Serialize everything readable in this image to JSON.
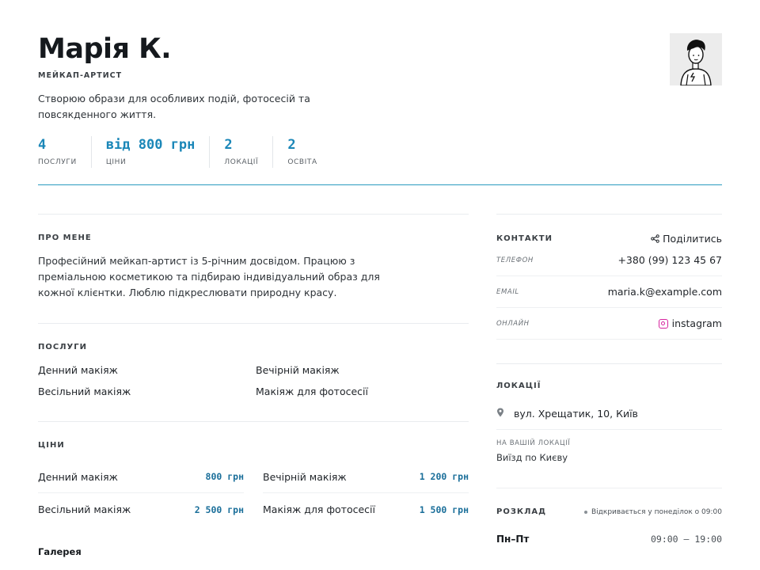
{
  "profile": {
    "name": "Марія К.",
    "role": "МЕЙКАП-АРТИСТ",
    "tagline": "Створюю образи для особливих подій, фотосесій та повсякденного життя."
  },
  "stats": [
    {
      "value": "4",
      "label": "ПОСЛУГИ"
    },
    {
      "value": "від 800 грн",
      "label": "ЦІНИ"
    },
    {
      "value": "2",
      "label": "ЛОКАЦІЇ"
    },
    {
      "value": "2",
      "label": "ОСВІТА"
    }
  ],
  "about": {
    "title": "ПРО МЕНЕ",
    "text": "Професійний мейкап-артист із 5-річним досвідом. Працюю з преміальною косметикою та підбираю індивідуальний образ для кожної клієнтки. Люблю підкреслювати природну красу."
  },
  "services": {
    "title": "ПОСЛУГИ",
    "items": [
      "Денний макіяж",
      "Вечірній макіяж",
      "Весільний макіяж",
      "Макіяж для фотосесії"
    ]
  },
  "prices": {
    "title": "ЦІНИ",
    "items": [
      {
        "name": "Денний макіяж",
        "price": "800 грн"
      },
      {
        "name": "Вечірній макіяж",
        "price": "1 200 грн"
      },
      {
        "name": "Весільний макіяж",
        "price": "2 500 грн"
      },
      {
        "name": "Макіяж для фотосесії",
        "price": "1 500 грн"
      }
    ]
  },
  "gallery": {
    "title": "Галерея"
  },
  "contacts": {
    "title": "КОНТАКТИ",
    "share_label": "Поділитись",
    "rows": [
      {
        "label": "ТЕЛЕФОН",
        "value": "+380 (99) 123 45 67"
      },
      {
        "label": "EMAIL",
        "value": "maria.k@example.com"
      },
      {
        "label": "ОНЛАЙН",
        "value": "instagram"
      }
    ]
  },
  "locations": {
    "title": "ЛОКАЦІЇ",
    "address": "вул. Хрещатик, 10, Київ",
    "onsite_label": "НА ВАШІЙ ЛОКАЦІЇ",
    "onsite_value": "Виїзд по Києву"
  },
  "schedule": {
    "title": "РОЗКЛАД",
    "opens": "Відкривається у понеділок о 09:00",
    "rows": [
      {
        "day": "Пн–Пт",
        "time": "09:00 — 19:00"
      }
    ]
  },
  "colors": {
    "accent": "#1b87b8",
    "divider": "#2a9bbf",
    "instagram": "#d6249f"
  },
  "icons": [
    "share-icon",
    "instagram-icon",
    "map-pin-icon",
    "status-dot-icon"
  ]
}
